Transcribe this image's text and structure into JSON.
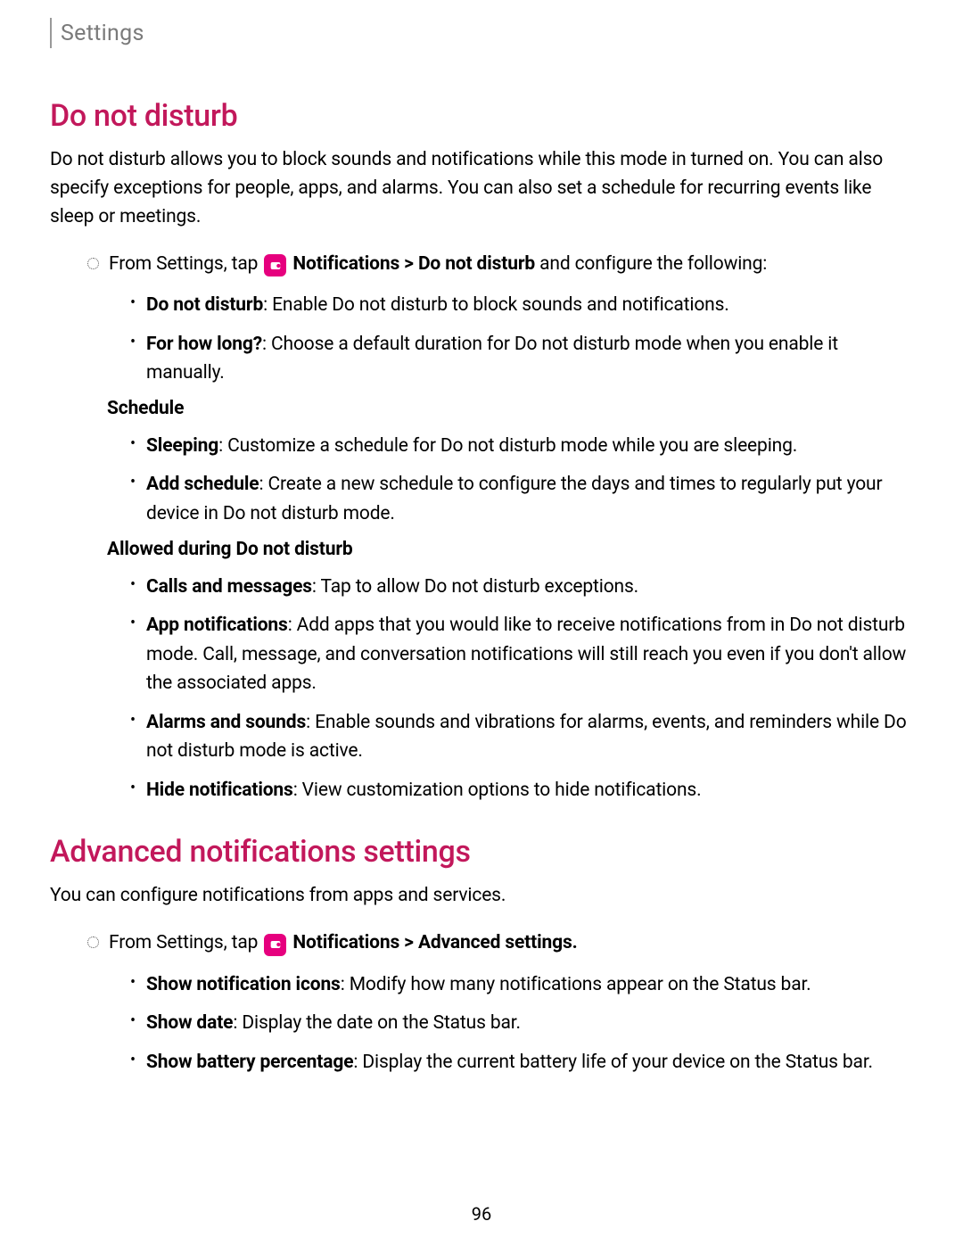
{
  "header": {
    "breadcrumb": "Settings"
  },
  "section1": {
    "title": "Do not disturb",
    "intro": "Do not disturb allows you to block sounds and notifications while this mode in turned on. You can also specify exceptions for people, apps, and alarms. You can also set a schedule for recurring events like sleep or meetings.",
    "step_prefix": "From Settings, tap ",
    "step_path1": "Notifications",
    "step_sep": " > ",
    "step_path2": "Do not disturb",
    "step_suffix": " and configure the following:",
    "items1": [
      {
        "label": "Do not disturb",
        "text": ": Enable Do not disturb to block sounds and notifications."
      },
      {
        "label": "For how long?",
        "text": ": Choose a default duration for Do not disturb mode when you enable it manually."
      }
    ],
    "sub1_title": "Schedule",
    "items2": [
      {
        "label": "Sleeping",
        "text": ": Customize a schedule for Do not disturb mode while you are sleeping."
      },
      {
        "label": "Add schedule",
        "text": ": Create a new schedule to configure the days and times to regularly put your device in Do not disturb mode."
      }
    ],
    "sub2_title": "Allowed during Do not disturb",
    "items3": [
      {
        "label": "Calls and messages",
        "text": ": Tap to allow Do not disturb exceptions."
      },
      {
        "label": "App notifications",
        "text": ": Add apps that you would like to receive notifications from in Do not disturb mode. Call, message, and conversation notifications will still reach you even if you don't allow the associated apps."
      },
      {
        "label": "Alarms and sounds",
        "text": ": Enable sounds and vibrations for alarms, events, and reminders while Do not disturb mode is active."
      },
      {
        "label": "Hide notifications",
        "text": ": View customization options to hide notifications."
      }
    ]
  },
  "section2": {
    "title": "Advanced notifications settings",
    "intro": "You can configure notifications from apps and services.",
    "step_prefix": "From Settings, tap ",
    "step_path1": "Notifications",
    "step_sep": " > ",
    "step_path2": "Advanced settings",
    "step_suffix": ".",
    "items1": [
      {
        "label": "Show notification icons",
        "text": ": Modify how many notifications appear on the Status bar."
      },
      {
        "label": "Show date",
        "text": ": Display the date on the Status bar."
      },
      {
        "label": "Show battery percentage",
        "text": ": Display the current battery life of your device on the Status bar."
      }
    ]
  },
  "page_number": "96"
}
